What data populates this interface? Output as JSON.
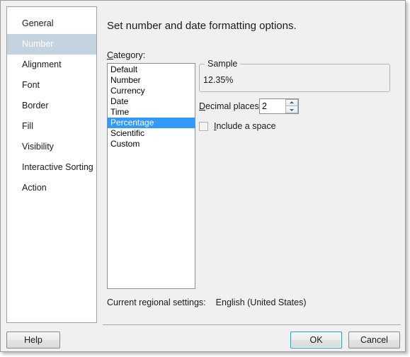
{
  "sidebar": {
    "items": [
      {
        "label": "General",
        "selected": false
      },
      {
        "label": "Number",
        "selected": true
      },
      {
        "label": "Alignment",
        "selected": false
      },
      {
        "label": "Font",
        "selected": false
      },
      {
        "label": "Border",
        "selected": false
      },
      {
        "label": "Fill",
        "selected": false
      },
      {
        "label": "Visibility",
        "selected": false
      },
      {
        "label": "Interactive Sorting",
        "selected": false
      },
      {
        "label": "Action",
        "selected": false
      }
    ]
  },
  "content": {
    "title": "Set number and date formatting options.",
    "category": {
      "label_accesskey": "C",
      "label_rest": "ategory:",
      "items": [
        {
          "label": "Default",
          "selected": false
        },
        {
          "label": "Number",
          "selected": false
        },
        {
          "label": "Currency",
          "selected": false
        },
        {
          "label": "Date",
          "selected": false
        },
        {
          "label": "Time",
          "selected": false
        },
        {
          "label": "Percentage",
          "selected": true
        },
        {
          "label": "Scientific",
          "selected": false
        },
        {
          "label": "Custom",
          "selected": false
        }
      ]
    },
    "sample": {
      "legend": "Sample",
      "value": "12.35%"
    },
    "decimal_places": {
      "label_accesskey": "D",
      "label_rest": "ecimal places:",
      "value": "2",
      "spin_up_icon": "chevron-up-icon",
      "spin_down_icon": "chevron-down-icon"
    },
    "include_space": {
      "label_accesskey": "I",
      "label_rest": "nclude a space",
      "checked": false
    },
    "regional": {
      "label": "Current regional settings:",
      "value": "English (United States)"
    }
  },
  "footer": {
    "help_label": "Help",
    "ok_label": "OK",
    "cancel_label": "Cancel"
  },
  "colors": {
    "dialog_background": "#f0f0f0",
    "sidebar_selection": "#c3d3e0",
    "list_selection": "#3399ff",
    "focus_ring": "#2f9ad4"
  }
}
